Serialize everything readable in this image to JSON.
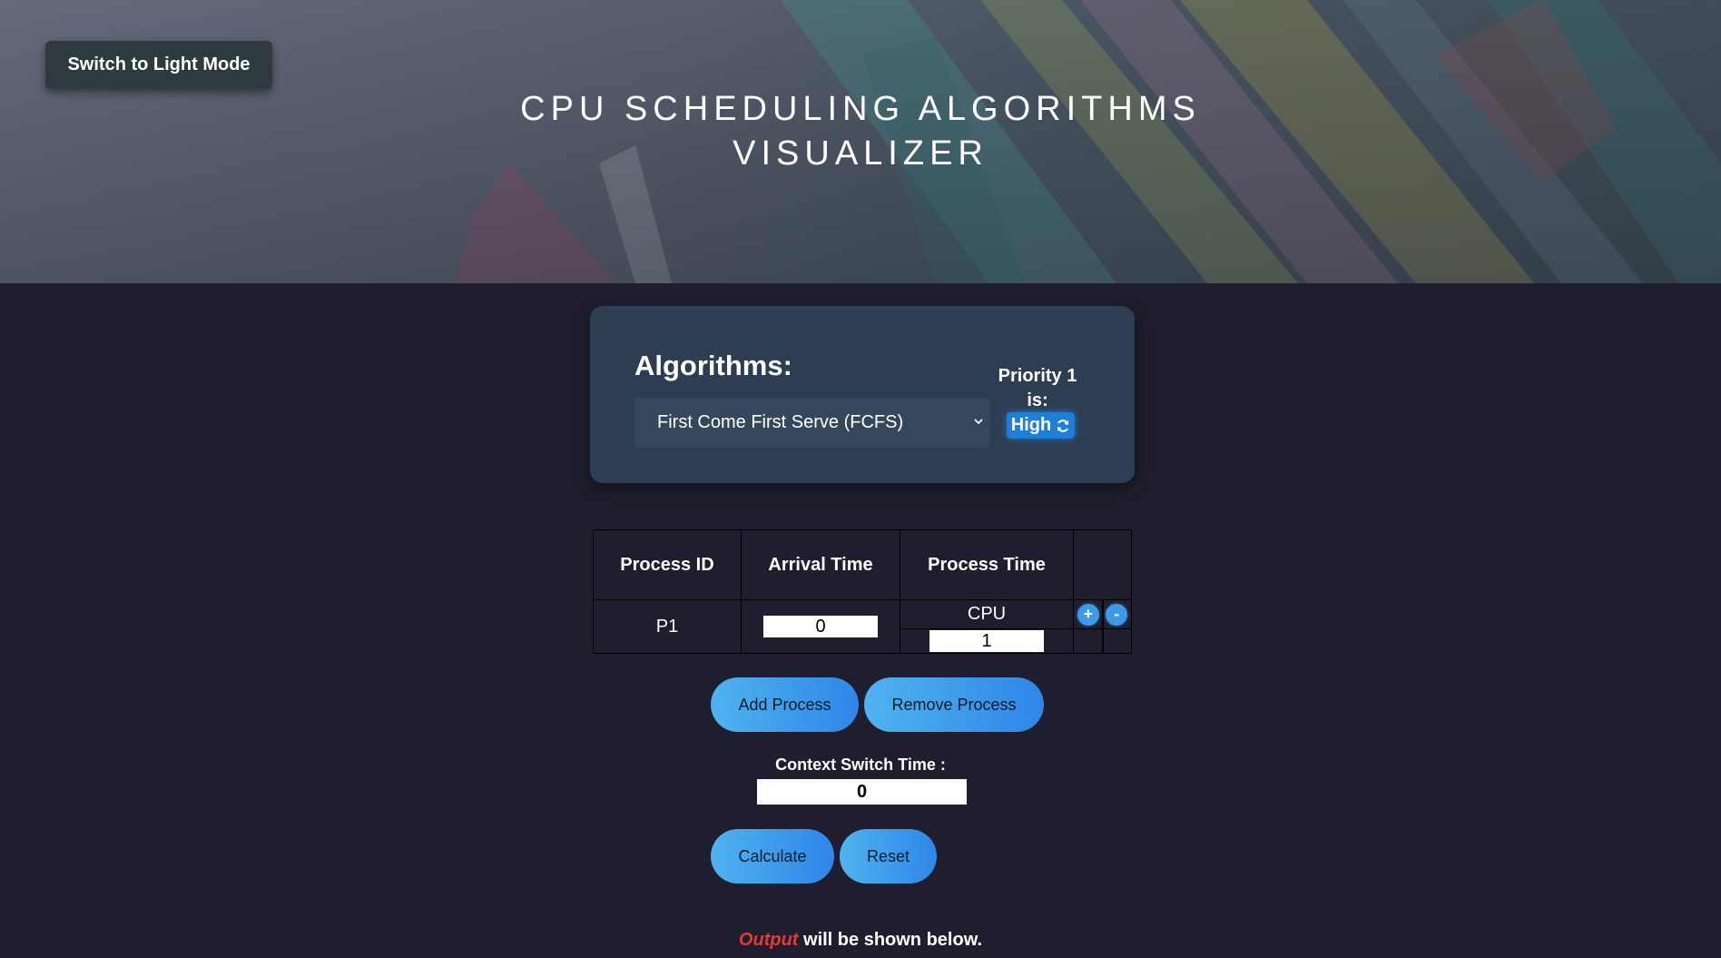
{
  "header": {
    "mode_toggle_label": "Switch to Light Mode",
    "title_line1": "CPU SCHEDULING ALGORITHMS",
    "title_line2": "VISUALIZER"
  },
  "algorithm_panel": {
    "label": "Algorithms:",
    "selected_algorithm": "First Come First Serve (FCFS)",
    "priority_label": "Priority 1 is:",
    "priority_value": "High",
    "priority_icon": "refresh-icon"
  },
  "process_table": {
    "headers": [
      "Process ID",
      "Arrival Time",
      "Process Time"
    ],
    "rows": [
      {
        "process_id": "P1",
        "arrival_time": "0",
        "burst_type": "CPU",
        "process_time": "1"
      }
    ],
    "add_burst_symbol": "+",
    "remove_burst_symbol": "-"
  },
  "buttons": {
    "add_process": "Add Process",
    "remove_process": "Remove Process",
    "calculate": "Calculate",
    "reset": "Reset"
  },
  "context_switch": {
    "label": "Context Switch Time :",
    "value": "0"
  },
  "output_note": {
    "highlight": "Output",
    "rest": " will be shown below."
  },
  "colors": {
    "page_background": "#1e1e2e",
    "card_background": "#2d3e52",
    "accent_blue": "#2f86e8",
    "output_highlight": "#e53935"
  }
}
